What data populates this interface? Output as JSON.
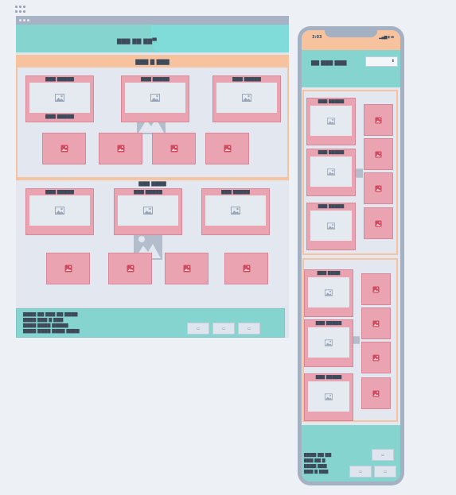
{
  "colors": {
    "accent_teal": "#86d4d0",
    "accent_peach": "#f7c39e",
    "card_pink": "#eaa4b1",
    "card_border": "#d88798",
    "icon_red": "#d24a60",
    "frame_gray": "#a3b1c3",
    "text_dark": "#3d4a5a"
  },
  "icons": {
    "grip": "grip-icon",
    "image_placeholder": "image-placeholder-icon",
    "image_red": "image-icon",
    "mountain_watermark": "mountain-image-icon",
    "signal": "signal-icon",
    "wifi": "wifi-icon",
    "battery": "battery-icon"
  },
  "desktop": {
    "header_title": "▇▇▇ ▇▇ ▇▇▀",
    "section1": {
      "title": "▇▇▇ ▇ ▇▇▇",
      "cards": [
        {
          "caption": "▇▇▇ ▇▇▇▇▇",
          "subcaption": "▇▇▇ ▇▇▇▇▇"
        },
        {
          "caption": "▇▇▇ ▇▇▇▇▇",
          "subcaption": ""
        },
        {
          "caption": "▇▇▇ ▇▇▇▇▇",
          "subcaption": ""
        }
      ]
    },
    "section2": {
      "title": "▇▇▇ ▇▇▇▇",
      "cards": [
        {
          "caption": "▇▇▇ ▇▇▇▇▇"
        },
        {
          "caption": "▇▇▇ ▇▇▇▇▇"
        },
        {
          "caption": "▇▇▇ ▇▇▇▇▇"
        }
      ]
    },
    "footer": {
      "lines": [
        "▇▇▇▇ ▇▇ ▇▇▇ ▇▇ ▇▇▇▇",
        "▇▇▇▇ ▇▇▇ ▇ ▇▇▇",
        "▇▇▇▇ ▇▇▇▇ ▇▇▇▇▇",
        "▇▇▇▇ ▇▇▇▇ ▇▇▇▇ ▇▇▇▇"
      ],
      "buttons": [
        "▫",
        "▫",
        "▫"
      ]
    }
  },
  "phone": {
    "time": "3:03",
    "status_icons": "▂▄▆ ◖ ▬",
    "header_title": "▇▇ ▇▇▇ ▇▇▇",
    "select_value": "⬍",
    "section1": {
      "cards": [
        {
          "caption": "▇▇▇ ▇▇▇▇▇"
        },
        {
          "caption": "▇▇▇ ▇▇▇▇▇"
        },
        {
          "caption": "▇▇▇ ▇▇▇▇▇"
        }
      ]
    },
    "section2": {
      "cards": [
        {
          "caption": "▇▇▇ ▇▇▇▇"
        },
        {
          "caption": "▇▇▇ ▇▇▇▇▇"
        },
        {
          "caption": "▇▇▇ ▇▇▇▇▇"
        }
      ]
    },
    "footer": {
      "lines": [
        "▇▇▇▇ ▇▇ ▇▇",
        "▇▇▇ ▇▇ ▇",
        "▇▇▇▇ ▇▇▇",
        "▇▇▇ ▇ ▇▇▇"
      ],
      "buttons": [
        "▫",
        "▫",
        "▫"
      ]
    }
  }
}
